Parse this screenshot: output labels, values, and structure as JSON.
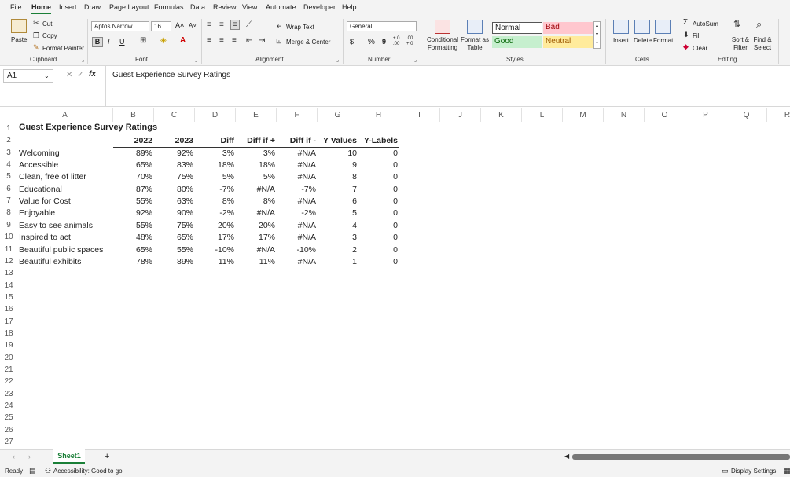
{
  "menu": [
    "File",
    "Home",
    "Insert",
    "Draw",
    "Page Layout",
    "Formulas",
    "Data",
    "Review",
    "View",
    "Automate",
    "Developer",
    "Help"
  ],
  "ribbon": {
    "clipboard": {
      "paste": "Paste",
      "cut": "Cut",
      "copy": "Copy",
      "format_painter": "Format Painter",
      "label": "Clipboard"
    },
    "font": {
      "family": "Aptos Narrow",
      "size": "16",
      "bold": "B",
      "italic": "I",
      "underline": "U",
      "label": "Font"
    },
    "alignment": {
      "wrap": "Wrap Text",
      "merge": "Merge & Center",
      "label": "Alignment"
    },
    "number": {
      "format": "General",
      "currency": "$",
      "percent": "%",
      "comma": "9",
      "inc_dec": "+.0 .00",
      "dec_dec": ".00 +.0",
      "label": "Number"
    },
    "styles": {
      "conditional": "Conditional Formatting",
      "format_table": "Format as Table",
      "normal": "Normal",
      "bad": "Bad",
      "good": "Good",
      "neutral": "Neutral",
      "label": "Styles"
    },
    "cells": {
      "insert": "Insert",
      "delete": "Delete",
      "format": "Format",
      "label": "Cells"
    },
    "editing": {
      "autosum": "AutoSum",
      "fill": "Fill",
      "clear": "Clear",
      "sort": "Sort & Filter",
      "find": "Find & Select",
      "label": "Editing"
    }
  },
  "formula_bar": {
    "name_box": "A1",
    "fx": "fx",
    "content": "Guest Experience Survey Ratings"
  },
  "columns": [
    "A",
    "B",
    "C",
    "D",
    "E",
    "F",
    "G",
    "H",
    "I",
    "J",
    "K",
    "L",
    "M",
    "N",
    "O",
    "P",
    "Q",
    "R"
  ],
  "sheet": {
    "title": "Guest Experience Survey Ratings",
    "headers": [
      "2022",
      "2023",
      "Diff",
      "Diff if +",
      "Diff if -",
      "Y Values",
      "Y-Labels"
    ],
    "rows": [
      [
        "Welcoming",
        "89%",
        "92%",
        "3%",
        "3%",
        "#N/A",
        "10",
        "0"
      ],
      [
        "Accessible",
        "65%",
        "83%",
        "18%",
        "18%",
        "#N/A",
        "9",
        "0"
      ],
      [
        "Clean, free of litter",
        "70%",
        "75%",
        "5%",
        "5%",
        "#N/A",
        "8",
        "0"
      ],
      [
        "Educational",
        "87%",
        "80%",
        "-7%",
        "#N/A",
        "-7%",
        "7",
        "0"
      ],
      [
        "Value for Cost",
        "55%",
        "63%",
        "8%",
        "8%",
        "#N/A",
        "6",
        "0"
      ],
      [
        "Enjoyable",
        "92%",
        "90%",
        "-2%",
        "#N/A",
        "-2%",
        "5",
        "0"
      ],
      [
        "Easy to see animals",
        "55%",
        "75%",
        "20%",
        "20%",
        "#N/A",
        "4",
        "0"
      ],
      [
        "Inspired to act",
        "48%",
        "65%",
        "17%",
        "17%",
        "#N/A",
        "3",
        "0"
      ],
      [
        "Beautiful public spaces",
        "65%",
        "55%",
        "-10%",
        "#N/A",
        "-10%",
        "2",
        "0"
      ],
      [
        "Beautiful exhibits",
        "78%",
        "89%",
        "11%",
        "11%",
        "#N/A",
        "1",
        "0"
      ]
    ]
  },
  "sheet_tab": "Sheet1",
  "status": {
    "ready": "Ready",
    "accessibility": "Accessibility: Good to go",
    "display": "Display Settings"
  }
}
